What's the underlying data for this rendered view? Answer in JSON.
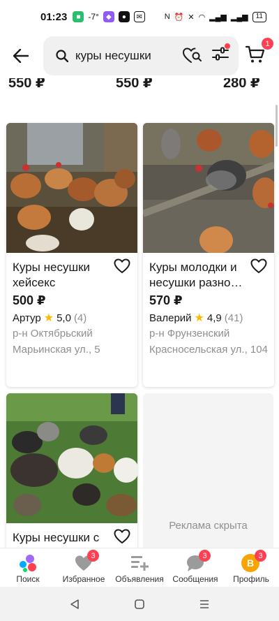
{
  "status_bar": {
    "time": "01:23",
    "temperature": "-7°",
    "battery": "11"
  },
  "header": {
    "search_query": "куры несушки",
    "cart_count": "1"
  },
  "prev_row_prices": [
    "550 ₽",
    "550 ₽",
    "280 ₽"
  ],
  "listings": [
    {
      "title": "Куры несушки хейсекс",
      "price": "500 ₽",
      "seller": "Артур",
      "rating": "5,0",
      "reviews": "(4)",
      "location_line1": "р-н Октябрьский",
      "location_line2": "Марьинская ул., 5"
    },
    {
      "title": "Куры молодки и несушки разно…",
      "price": "570 ₽",
      "seller": "Валерий",
      "rating": "4,9",
      "reviews": "(41)",
      "location_line1": "р-н Фрунзенский",
      "location_line2": "Красносельская ул., 104"
    },
    {
      "title": "Куры несушки с"
    }
  ],
  "ad_hidden_text": "Реклама скрыта",
  "bottom_nav": [
    {
      "label": "Поиск",
      "icon": "search-logo-icon",
      "badge": ""
    },
    {
      "label": "Избранное",
      "icon": "heart-icon",
      "badge": "3"
    },
    {
      "label": "Объявления",
      "icon": "add-listing-icon",
      "badge": ""
    },
    {
      "label": "Сообщения",
      "icon": "chat-icon",
      "badge": "3"
    },
    {
      "label": "Профиль",
      "icon": "avatar-icon",
      "badge": "3",
      "avatar_letter": "В"
    }
  ],
  "colors": {
    "accent": "#ff4053",
    "star": "#ffb800",
    "muted": "#8f8f8f",
    "avatar": "#f7a400"
  }
}
